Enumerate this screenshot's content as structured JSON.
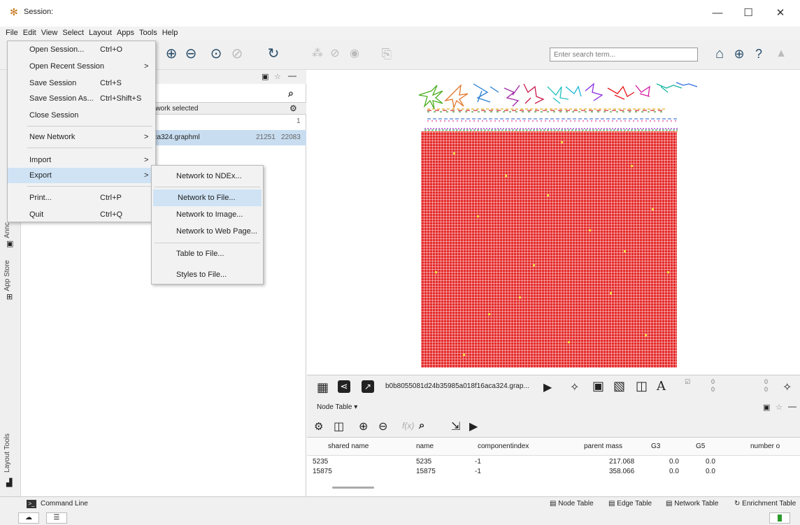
{
  "window": {
    "title": "Session:",
    "min": "—",
    "max": "☐",
    "close": "✕"
  },
  "menubar": [
    "File",
    "Edit",
    "View",
    "Select",
    "Layout",
    "Apps",
    "Tools",
    "Help"
  ],
  "toolbar": {
    "search_placeholder": "Enter search term..."
  },
  "left_tabs": {
    "annotation": "Annc",
    "app_store": "App Store",
    "layout_tools": "Layout Tools"
  },
  "network_panel": {
    "selected_text": "etwork selected",
    "count_row": "1",
    "network_name": "aca324.graphml",
    "nodes": "21251",
    "edges": "22083"
  },
  "file_menu": [
    {
      "label": "Open Session...",
      "accel": "Ctrl+O"
    },
    {
      "label": "Open Recent Session",
      "arrow": ">"
    },
    {
      "label": "Save Session",
      "accel": "Ctrl+S"
    },
    {
      "label": "Save Session As...",
      "accel": "Ctrl+Shift+S"
    },
    {
      "label": "Close Session"
    },
    {
      "label": "New Network",
      "arrow": ">"
    },
    {
      "label": "Import",
      "arrow": ">"
    },
    {
      "label": "Export",
      "arrow": ">"
    },
    {
      "label": "Print...",
      "accel": "Ctrl+P"
    },
    {
      "label": "Quit",
      "accel": "Ctrl+Q"
    }
  ],
  "export_menu": [
    "Network to NDEx...",
    "Network to File...",
    "Network to Image...",
    "Network to Web Page...",
    "Table to File...",
    "Styles to File..."
  ],
  "view_bar": {
    "network_title": "b0b8055081d24b35985a018f16aca324.grap...",
    "sel_counts": [
      "0",
      "0",
      "0",
      "0"
    ]
  },
  "node_table": {
    "title": "Node Table ▾",
    "columns": [
      "shared name",
      "name",
      "componentindex",
      "parent mass",
      "G3",
      "G5",
      "number o"
    ],
    "rows": [
      [
        "5235",
        "5235",
        "-1",
        "217.068",
        "0.0",
        "0.0"
      ],
      [
        "15875",
        "15875",
        "-1",
        "358.066",
        "0.0",
        "0.0"
      ]
    ]
  },
  "status": {
    "command_line": "Command Line"
  },
  "bottom_tabs": [
    "Node Table",
    "Edge Table",
    "Network Table",
    "Enrichment Table"
  ],
  "colors": {
    "grid": "#e52a2a",
    "highlight": "#cfe3f5",
    "toolbar_icon": "#2c4f6b"
  }
}
